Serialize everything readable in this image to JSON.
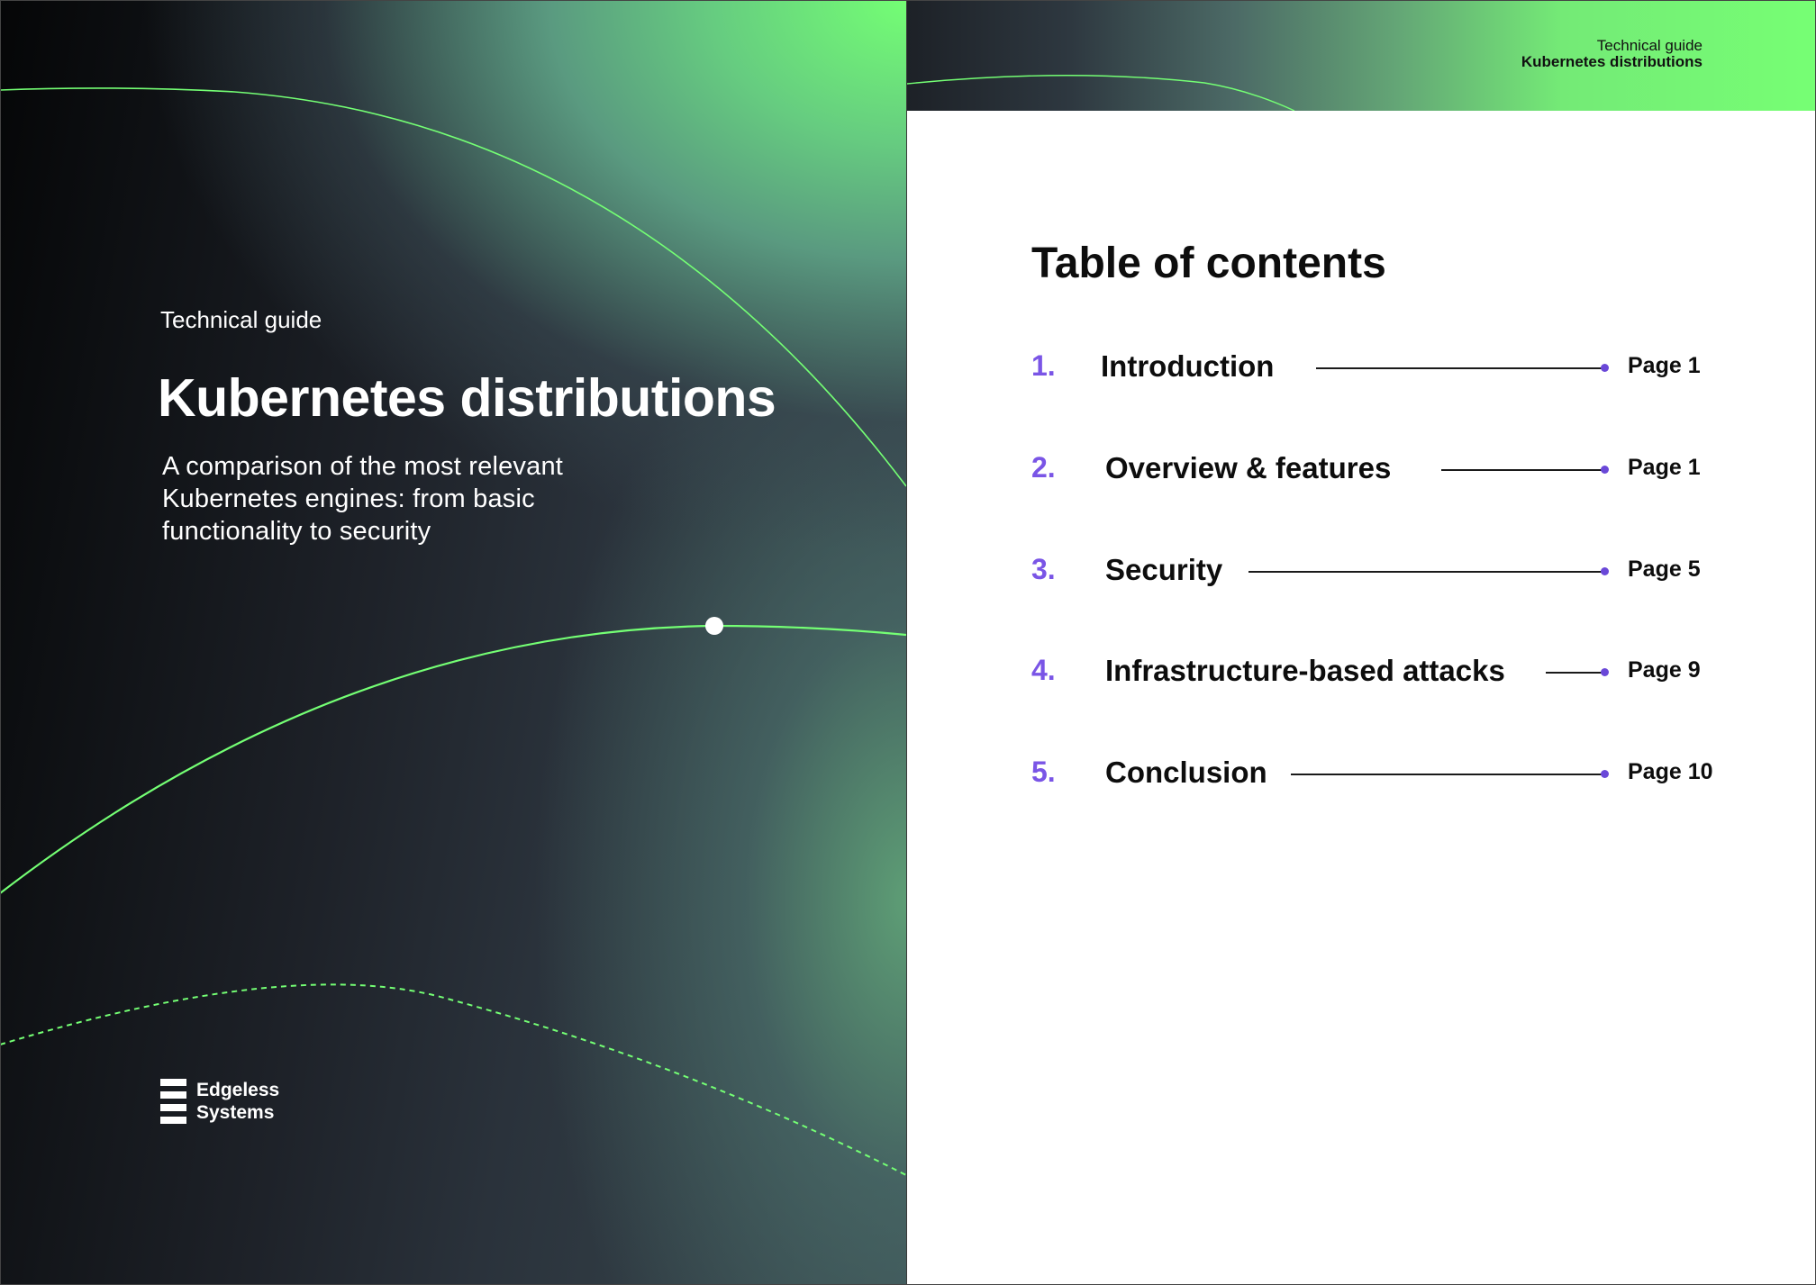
{
  "cover": {
    "eyebrow": "Technical guide",
    "title": "Kubernetes distributions",
    "subtitle": "A comparison of the most relevant Kubernetes engines: from basic functionality to security",
    "logo": {
      "line1": "Edgeless",
      "line2": "Systems",
      "icon": "stacked-bars-logo-icon"
    },
    "colors": {
      "accent_green": "#74ff74",
      "dark": "#0a0b0d"
    }
  },
  "header": {
    "line1": "Technical guide",
    "line2": "Kubernetes distributions"
  },
  "toc": {
    "title": "Table of contents",
    "number_color": "#7a55e6",
    "items": [
      {
        "number": "1.",
        "label": "Introduction",
        "page": "Page 1"
      },
      {
        "number": "2.",
        "label": "Overview & features",
        "page": "Page 1"
      },
      {
        "number": "3.",
        "label": "Security",
        "page": "Page 5"
      },
      {
        "number": "4.",
        "label": "Infrastructure-based attacks",
        "page": "Page 9"
      },
      {
        "number": "5.",
        "label": "Conclusion",
        "page": "Page 10"
      }
    ]
  }
}
